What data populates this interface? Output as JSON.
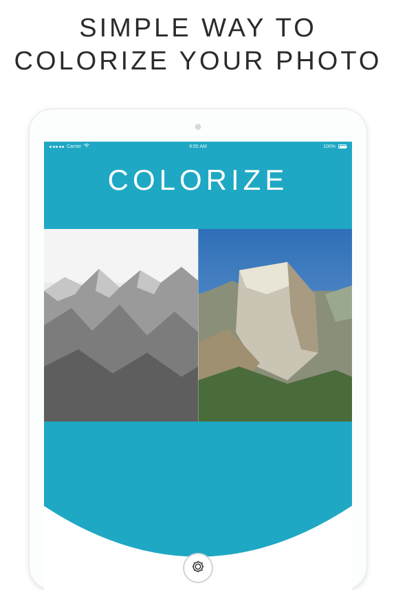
{
  "promo": {
    "line1": "SIMPLE WAY TO",
    "line2": "COLORIZE YOUR PHOTO"
  },
  "status_bar": {
    "carrier": "Carrier",
    "time": "9:55 AM",
    "battery": "100%"
  },
  "app": {
    "title": "COLORIZE"
  },
  "colors": {
    "teal": "#1fa8c4",
    "white": "#ffffff",
    "text": "#2a2a2a"
  },
  "icons": {
    "camera": "camera-icon",
    "wifi": "wifi-icon",
    "battery": "battery-icon"
  }
}
